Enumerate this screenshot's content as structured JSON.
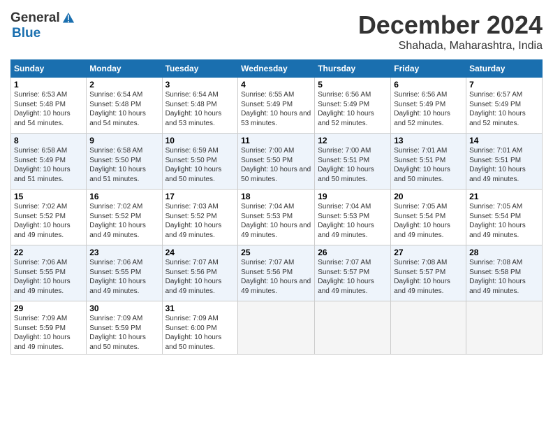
{
  "header": {
    "logo_general": "General",
    "logo_blue": "Blue",
    "month_title": "December 2024",
    "location": "Shahada, Maharashtra, India"
  },
  "days_of_week": [
    "Sunday",
    "Monday",
    "Tuesday",
    "Wednesday",
    "Thursday",
    "Friday",
    "Saturday"
  ],
  "weeks": [
    [
      {
        "day": "1",
        "sunrise": "6:53 AM",
        "sunset": "5:48 PM",
        "daylight": "10 hours and 54 minutes."
      },
      {
        "day": "2",
        "sunrise": "6:54 AM",
        "sunset": "5:48 PM",
        "daylight": "10 hours and 54 minutes."
      },
      {
        "day": "3",
        "sunrise": "6:54 AM",
        "sunset": "5:48 PM",
        "daylight": "10 hours and 53 minutes."
      },
      {
        "day": "4",
        "sunrise": "6:55 AM",
        "sunset": "5:49 PM",
        "daylight": "10 hours and 53 minutes."
      },
      {
        "day": "5",
        "sunrise": "6:56 AM",
        "sunset": "5:49 PM",
        "daylight": "10 hours and 52 minutes."
      },
      {
        "day": "6",
        "sunrise": "6:56 AM",
        "sunset": "5:49 PM",
        "daylight": "10 hours and 52 minutes."
      },
      {
        "day": "7",
        "sunrise": "6:57 AM",
        "sunset": "5:49 PM",
        "daylight": "10 hours and 52 minutes."
      }
    ],
    [
      {
        "day": "8",
        "sunrise": "6:58 AM",
        "sunset": "5:49 PM",
        "daylight": "10 hours and 51 minutes."
      },
      {
        "day": "9",
        "sunrise": "6:58 AM",
        "sunset": "5:50 PM",
        "daylight": "10 hours and 51 minutes."
      },
      {
        "day": "10",
        "sunrise": "6:59 AM",
        "sunset": "5:50 PM",
        "daylight": "10 hours and 50 minutes."
      },
      {
        "day": "11",
        "sunrise": "7:00 AM",
        "sunset": "5:50 PM",
        "daylight": "10 hours and 50 minutes."
      },
      {
        "day": "12",
        "sunrise": "7:00 AM",
        "sunset": "5:51 PM",
        "daylight": "10 hours and 50 minutes."
      },
      {
        "day": "13",
        "sunrise": "7:01 AM",
        "sunset": "5:51 PM",
        "daylight": "10 hours and 50 minutes."
      },
      {
        "day": "14",
        "sunrise": "7:01 AM",
        "sunset": "5:51 PM",
        "daylight": "10 hours and 49 minutes."
      }
    ],
    [
      {
        "day": "15",
        "sunrise": "7:02 AM",
        "sunset": "5:52 PM",
        "daylight": "10 hours and 49 minutes."
      },
      {
        "day": "16",
        "sunrise": "7:02 AM",
        "sunset": "5:52 PM",
        "daylight": "10 hours and 49 minutes."
      },
      {
        "day": "17",
        "sunrise": "7:03 AM",
        "sunset": "5:52 PM",
        "daylight": "10 hours and 49 minutes."
      },
      {
        "day": "18",
        "sunrise": "7:04 AM",
        "sunset": "5:53 PM",
        "daylight": "10 hours and 49 minutes."
      },
      {
        "day": "19",
        "sunrise": "7:04 AM",
        "sunset": "5:53 PM",
        "daylight": "10 hours and 49 minutes."
      },
      {
        "day": "20",
        "sunrise": "7:05 AM",
        "sunset": "5:54 PM",
        "daylight": "10 hours and 49 minutes."
      },
      {
        "day": "21",
        "sunrise": "7:05 AM",
        "sunset": "5:54 PM",
        "daylight": "10 hours and 49 minutes."
      }
    ],
    [
      {
        "day": "22",
        "sunrise": "7:06 AM",
        "sunset": "5:55 PM",
        "daylight": "10 hours and 49 minutes."
      },
      {
        "day": "23",
        "sunrise": "7:06 AM",
        "sunset": "5:55 PM",
        "daylight": "10 hours and 49 minutes."
      },
      {
        "day": "24",
        "sunrise": "7:07 AM",
        "sunset": "5:56 PM",
        "daylight": "10 hours and 49 minutes."
      },
      {
        "day": "25",
        "sunrise": "7:07 AM",
        "sunset": "5:56 PM",
        "daylight": "10 hours and 49 minutes."
      },
      {
        "day": "26",
        "sunrise": "7:07 AM",
        "sunset": "5:57 PM",
        "daylight": "10 hours and 49 minutes."
      },
      {
        "day": "27",
        "sunrise": "7:08 AM",
        "sunset": "5:57 PM",
        "daylight": "10 hours and 49 minutes."
      },
      {
        "day": "28",
        "sunrise": "7:08 AM",
        "sunset": "5:58 PM",
        "daylight": "10 hours and 49 minutes."
      }
    ],
    [
      {
        "day": "29",
        "sunrise": "7:09 AM",
        "sunset": "5:59 PM",
        "daylight": "10 hours and 49 minutes."
      },
      {
        "day": "30",
        "sunrise": "7:09 AM",
        "sunset": "5:59 PM",
        "daylight": "10 hours and 50 minutes."
      },
      {
        "day": "31",
        "sunrise": "7:09 AM",
        "sunset": "6:00 PM",
        "daylight": "10 hours and 50 minutes."
      },
      null,
      null,
      null,
      null
    ]
  ]
}
